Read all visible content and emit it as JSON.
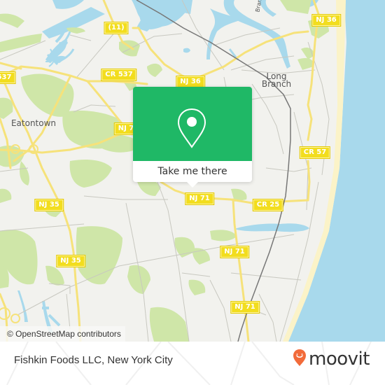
{
  "map": {
    "attribution": "© OpenStreetMap contributors",
    "place_labels": {
      "eatontown": "Eatontown",
      "long": "Long",
      "branch": "Branch",
      "branch_river": "Bran"
    },
    "shields": {
      "r11": "(11)",
      "cr537": "CR 537",
      "cr537_left": "537",
      "nj36_top": "NJ 36",
      "nj36_mid": "NJ 36",
      "nj7": "NJ 7",
      "nj71_a": "NJ 71",
      "nj71_b": "NJ 71",
      "nj71_c": "NJ 71",
      "cr25": "CR 25",
      "cr57": "CR 57",
      "nj35_a": "NJ 35",
      "nj35_b": "NJ 35"
    },
    "colors": {
      "land": "#f2f2ee",
      "water": "#a8d9ec",
      "park": "#cfe6a8",
      "road_major": "#f6e27a",
      "road_minor": "#c8c8c0",
      "rail": "#777777",
      "beach": "#fbf3c8"
    }
  },
  "popup": {
    "icon": "location-pin-icon",
    "button_label": "Take me there",
    "accent": "#1fb866"
  },
  "footer": {
    "place_title": "Fishkin Foods LLC, New York City",
    "brand": "moovit",
    "brand_color": "#f26b3a"
  }
}
